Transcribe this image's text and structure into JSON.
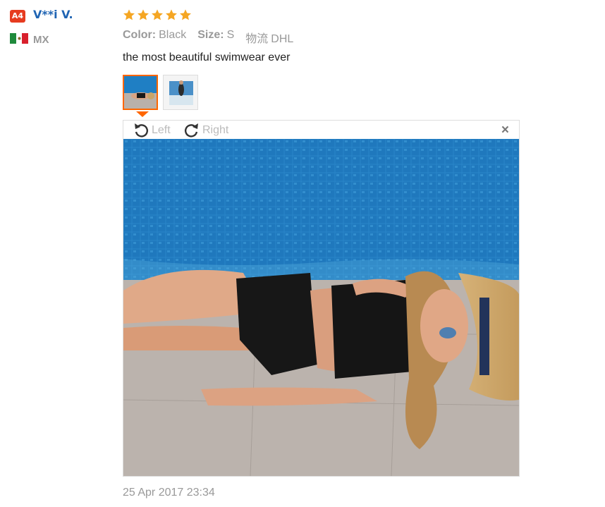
{
  "reviewer": {
    "badge": "A4",
    "name": "V**i V.",
    "country": "MX",
    "flag_colors": [
      "#1f8a3c",
      "#ffffff",
      "#d8202c"
    ]
  },
  "review": {
    "rating": 5,
    "stars_color": "#f5a623",
    "attributes": [
      {
        "key": "Color:",
        "value": "Black"
      },
      {
        "key": "Size:",
        "value": "S"
      },
      {
        "key": "物流",
        "value": "DHL"
      }
    ],
    "comment": "the most beautiful swimwear ever",
    "date": "25 Apr 2017 23:34"
  },
  "viewer": {
    "rotate_left_label": "Left",
    "rotate_right_label": "Right",
    "close_glyph": "×",
    "accent": "#ff6600"
  }
}
